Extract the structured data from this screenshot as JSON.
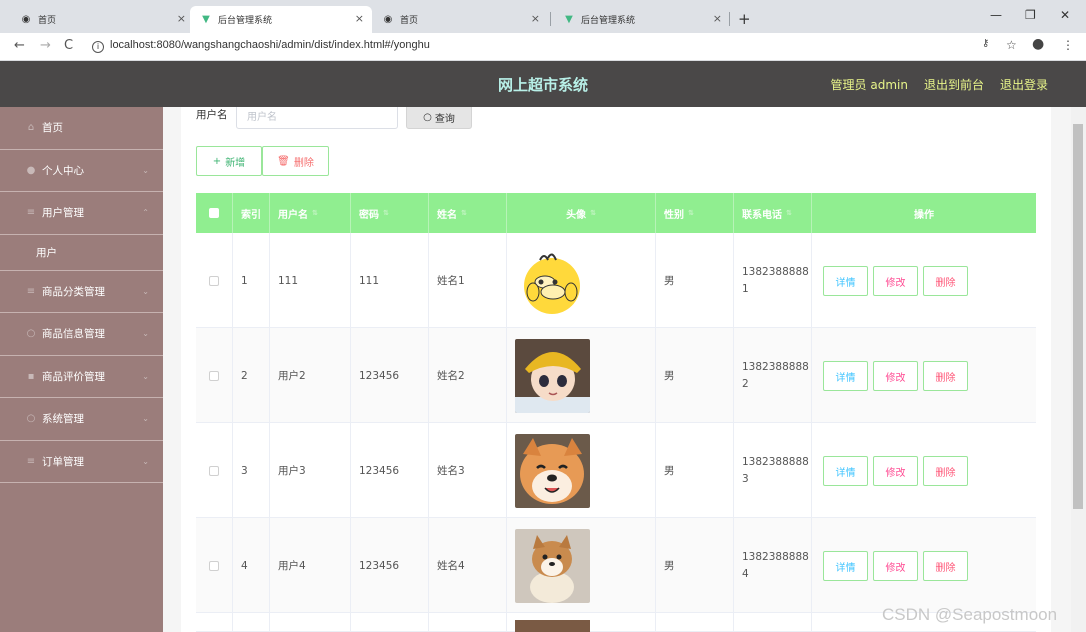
{
  "browser": {
    "tabs": [
      {
        "title": "首页",
        "icon": "globe-icon",
        "active": false
      },
      {
        "title": "后台管理系统",
        "icon": "vue-icon",
        "active": true
      },
      {
        "title": "首页",
        "icon": "globe-icon",
        "active": false
      },
      {
        "title": "后台管理系统",
        "icon": "vue-icon",
        "active": false
      }
    ],
    "url": "localhost:8080/wangshangchaoshi/admin/dist/index.html#/yonghu"
  },
  "header": {
    "title": "网上超市系统",
    "user": "管理员 admin",
    "back_front": "退出到前台",
    "logout": "退出登录"
  },
  "sidebar": {
    "items": [
      {
        "label": "首页",
        "icon": "home-icon"
      },
      {
        "label": "个人中心",
        "icon": "user-icon"
      },
      {
        "label": "用户管理",
        "icon": "users-icon",
        "expanded": true,
        "children": [
          {
            "label": "用户"
          }
        ]
      },
      {
        "label": "商品分类管理",
        "icon": "list-icon"
      },
      {
        "label": "商品信息管理",
        "icon": "info-icon"
      },
      {
        "label": "商品评价管理",
        "icon": "comment-icon"
      },
      {
        "label": "系统管理",
        "icon": "gear-icon"
      },
      {
        "label": "订单管理",
        "icon": "order-icon"
      }
    ]
  },
  "search": {
    "label": "用户名",
    "placeholder": "用户名",
    "button": "查询"
  },
  "actions": {
    "add": "新增",
    "delete": "删除"
  },
  "table": {
    "headers": [
      "索引",
      "用户名",
      "密码",
      "姓名",
      "头像",
      "性别",
      "联系电话",
      "操作"
    ],
    "rows": [
      {
        "index": "1",
        "username": "111",
        "password": "111",
        "name": "姓名1",
        "gender": "男",
        "phone_a": "1382388888",
        "phone_b": "1",
        "avatar": "cartoon-duck"
      },
      {
        "index": "2",
        "username": "用户2",
        "password": "123456",
        "name": "姓名2",
        "gender": "男",
        "phone_a": "1382388888",
        "phone_b": "2",
        "avatar": "anime-boy"
      },
      {
        "index": "3",
        "username": "用户3",
        "password": "123456",
        "name": "姓名3",
        "gender": "男",
        "phone_a": "1382388888",
        "phone_b": "3",
        "avatar": "shiba-dog"
      },
      {
        "index": "4",
        "username": "用户4",
        "password": "123456",
        "name": "姓名4",
        "gender": "男",
        "phone_a": "1382388888",
        "phone_b": "4",
        "avatar": "shiba-puppy"
      }
    ],
    "row_actions": {
      "detail": "详情",
      "edit": "修改",
      "remove": "删除"
    }
  },
  "watermark": "CSDN @Seapostmoon"
}
